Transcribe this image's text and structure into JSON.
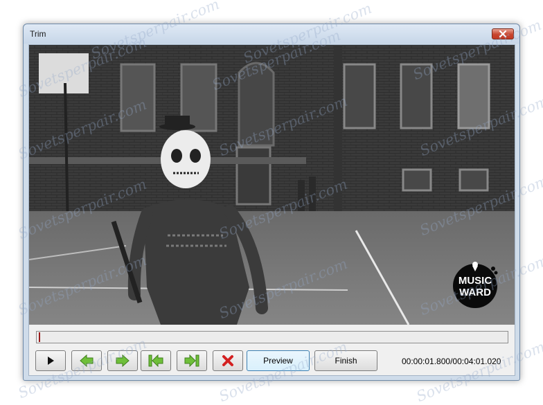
{
  "window": {
    "title": "Trim"
  },
  "controls": {
    "preview_label": "Preview",
    "finish_label": "Finish",
    "time_readout": "00:00:01.800/00:04:01.020"
  },
  "timeline": {
    "position_fraction": 0.004
  },
  "logo": {
    "line1": "MUSIC",
    "line2": "WARD"
  },
  "watermark": {
    "text": "Sovetsperpair.com"
  },
  "colors": {
    "arrow_green": "#6fbf3a",
    "delete_red": "#d42020",
    "close_red": "#c8452e",
    "timeline_marker": "#9b1b1b"
  },
  "icons": {
    "play": "play-icon",
    "prev_frame": "arrow-left-icon",
    "next_frame": "arrow-right-icon",
    "set_start": "set-start-icon",
    "set_end": "set-end-icon",
    "delete": "delete-icon",
    "close": "close-icon"
  }
}
